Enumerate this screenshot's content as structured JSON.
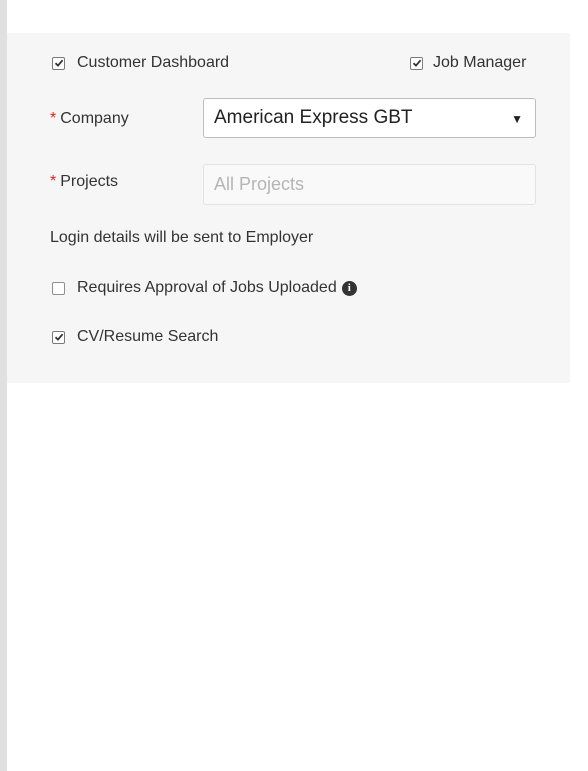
{
  "form": {
    "customer_dashboard": {
      "label": "Customer Dashboard",
      "checked": true
    },
    "job_manager": {
      "label": "Job Manager",
      "checked": true
    },
    "company": {
      "required_mark": "*",
      "label": "Company",
      "value": "American Express GBT",
      "arrow": "▼"
    },
    "projects": {
      "required_mark": "*",
      "label": "Projects",
      "placeholder": "All Projects"
    },
    "login_note": "Login details will be sent to Employer",
    "requires_approval": {
      "label": "Requires Approval of Jobs Uploaded",
      "checked": false,
      "info_icon": "i"
    },
    "cv_resume_search": {
      "label": "CV/Resume Search",
      "checked": true
    }
  },
  "icons": {
    "checkmark": "checkmark-icon",
    "info": "info-circle-icon",
    "dropdown": "caret-down-icon"
  }
}
